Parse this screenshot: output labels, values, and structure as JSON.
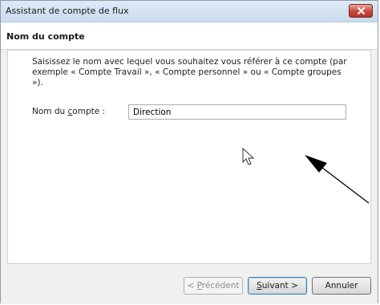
{
  "window": {
    "title": "Assistant de compte de flux"
  },
  "header": {
    "title": "Nom du compte"
  },
  "content": {
    "instructions": "Saisissez le nom avec lequel vous souhaitez vous référer à ce compte (par exemple « Compte Travail », « Compte personnel » ou « Compte groupes »).",
    "field_label_before": "Nom du ",
    "field_label_accel": "c",
    "field_label_after": "ompte :",
    "field_value": "Direction"
  },
  "buttons": {
    "prev_prefix": "< ",
    "prev_accel": "P",
    "prev_rest": "récédent",
    "next_accel": "S",
    "next_rest": "uivant >",
    "cancel": "Annuler"
  },
  "icons": {
    "close": "close-icon",
    "cursor": "mouse-cursor-icon",
    "annotation": "annotation-arrow-icon"
  },
  "colors": {
    "close_button": "#c8473a",
    "titlebar": "#c9daee",
    "default_button_border": "#3c7fb1"
  }
}
